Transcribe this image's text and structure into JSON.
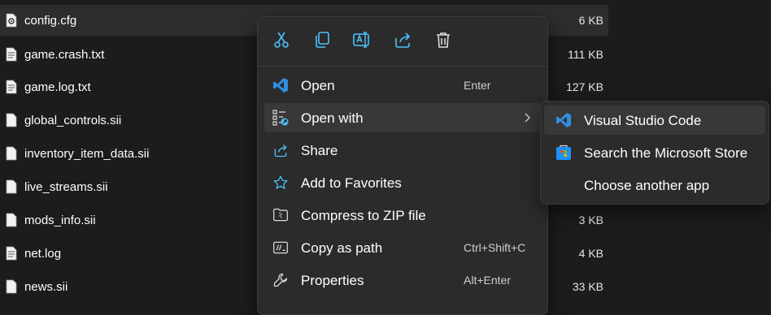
{
  "files": [
    {
      "name": "config.cfg",
      "size": "6 KB",
      "icon": "settings-file-icon"
    },
    {
      "name": "game.crash.txt",
      "size": "111 KB",
      "icon": "text-file-icon"
    },
    {
      "name": "game.log.txt",
      "size": "127 KB",
      "icon": "text-file-icon"
    },
    {
      "name": "global_controls.sii",
      "size": "",
      "icon": "file-icon"
    },
    {
      "name": "inventory_item_data.sii",
      "size": "",
      "icon": "file-icon"
    },
    {
      "name": "live_streams.sii",
      "size": "",
      "icon": "file-icon"
    },
    {
      "name": "mods_info.sii",
      "size": "3 KB",
      "icon": "file-icon"
    },
    {
      "name": "net.log",
      "size": "4 KB",
      "icon": "text-file-icon"
    },
    {
      "name": "news.sii",
      "size": "33 KB",
      "icon": "file-icon"
    }
  ],
  "context_menu": {
    "toolbar": [
      "cut-icon",
      "copy-icon",
      "rename-icon",
      "share-icon",
      "delete-icon"
    ],
    "items": [
      {
        "label": "Open",
        "shortcut": "Enter",
        "icon": "vscode-icon"
      },
      {
        "label": "Open with",
        "shortcut": "",
        "icon": "open-with-icon",
        "submenu": true
      },
      {
        "label": "Share",
        "shortcut": "",
        "icon": "share-icon"
      },
      {
        "label": "Add to Favorites",
        "shortcut": "",
        "icon": "star-icon"
      },
      {
        "label": "Compress to ZIP file",
        "shortcut": "",
        "icon": "zip-icon"
      },
      {
        "label": "Copy as path",
        "shortcut": "Ctrl+Shift+C",
        "icon": "copy-path-icon"
      },
      {
        "label": "Properties",
        "shortcut": "Alt+Enter",
        "icon": "wrench-icon"
      }
    ]
  },
  "submenu": {
    "items": [
      {
        "label": "Visual Studio Code",
        "icon": "vscode-icon"
      },
      {
        "label": "Search the Microsoft Store",
        "icon": "microsoft-store-icon"
      },
      {
        "label": "Choose another app",
        "icon": ""
      }
    ]
  },
  "colors": {
    "background": "#1c1c1c",
    "menu_background": "#2b2b2b",
    "hover": "#383838",
    "accent": "#4cc2ff",
    "vscode_blue": "#2f8fe0"
  }
}
